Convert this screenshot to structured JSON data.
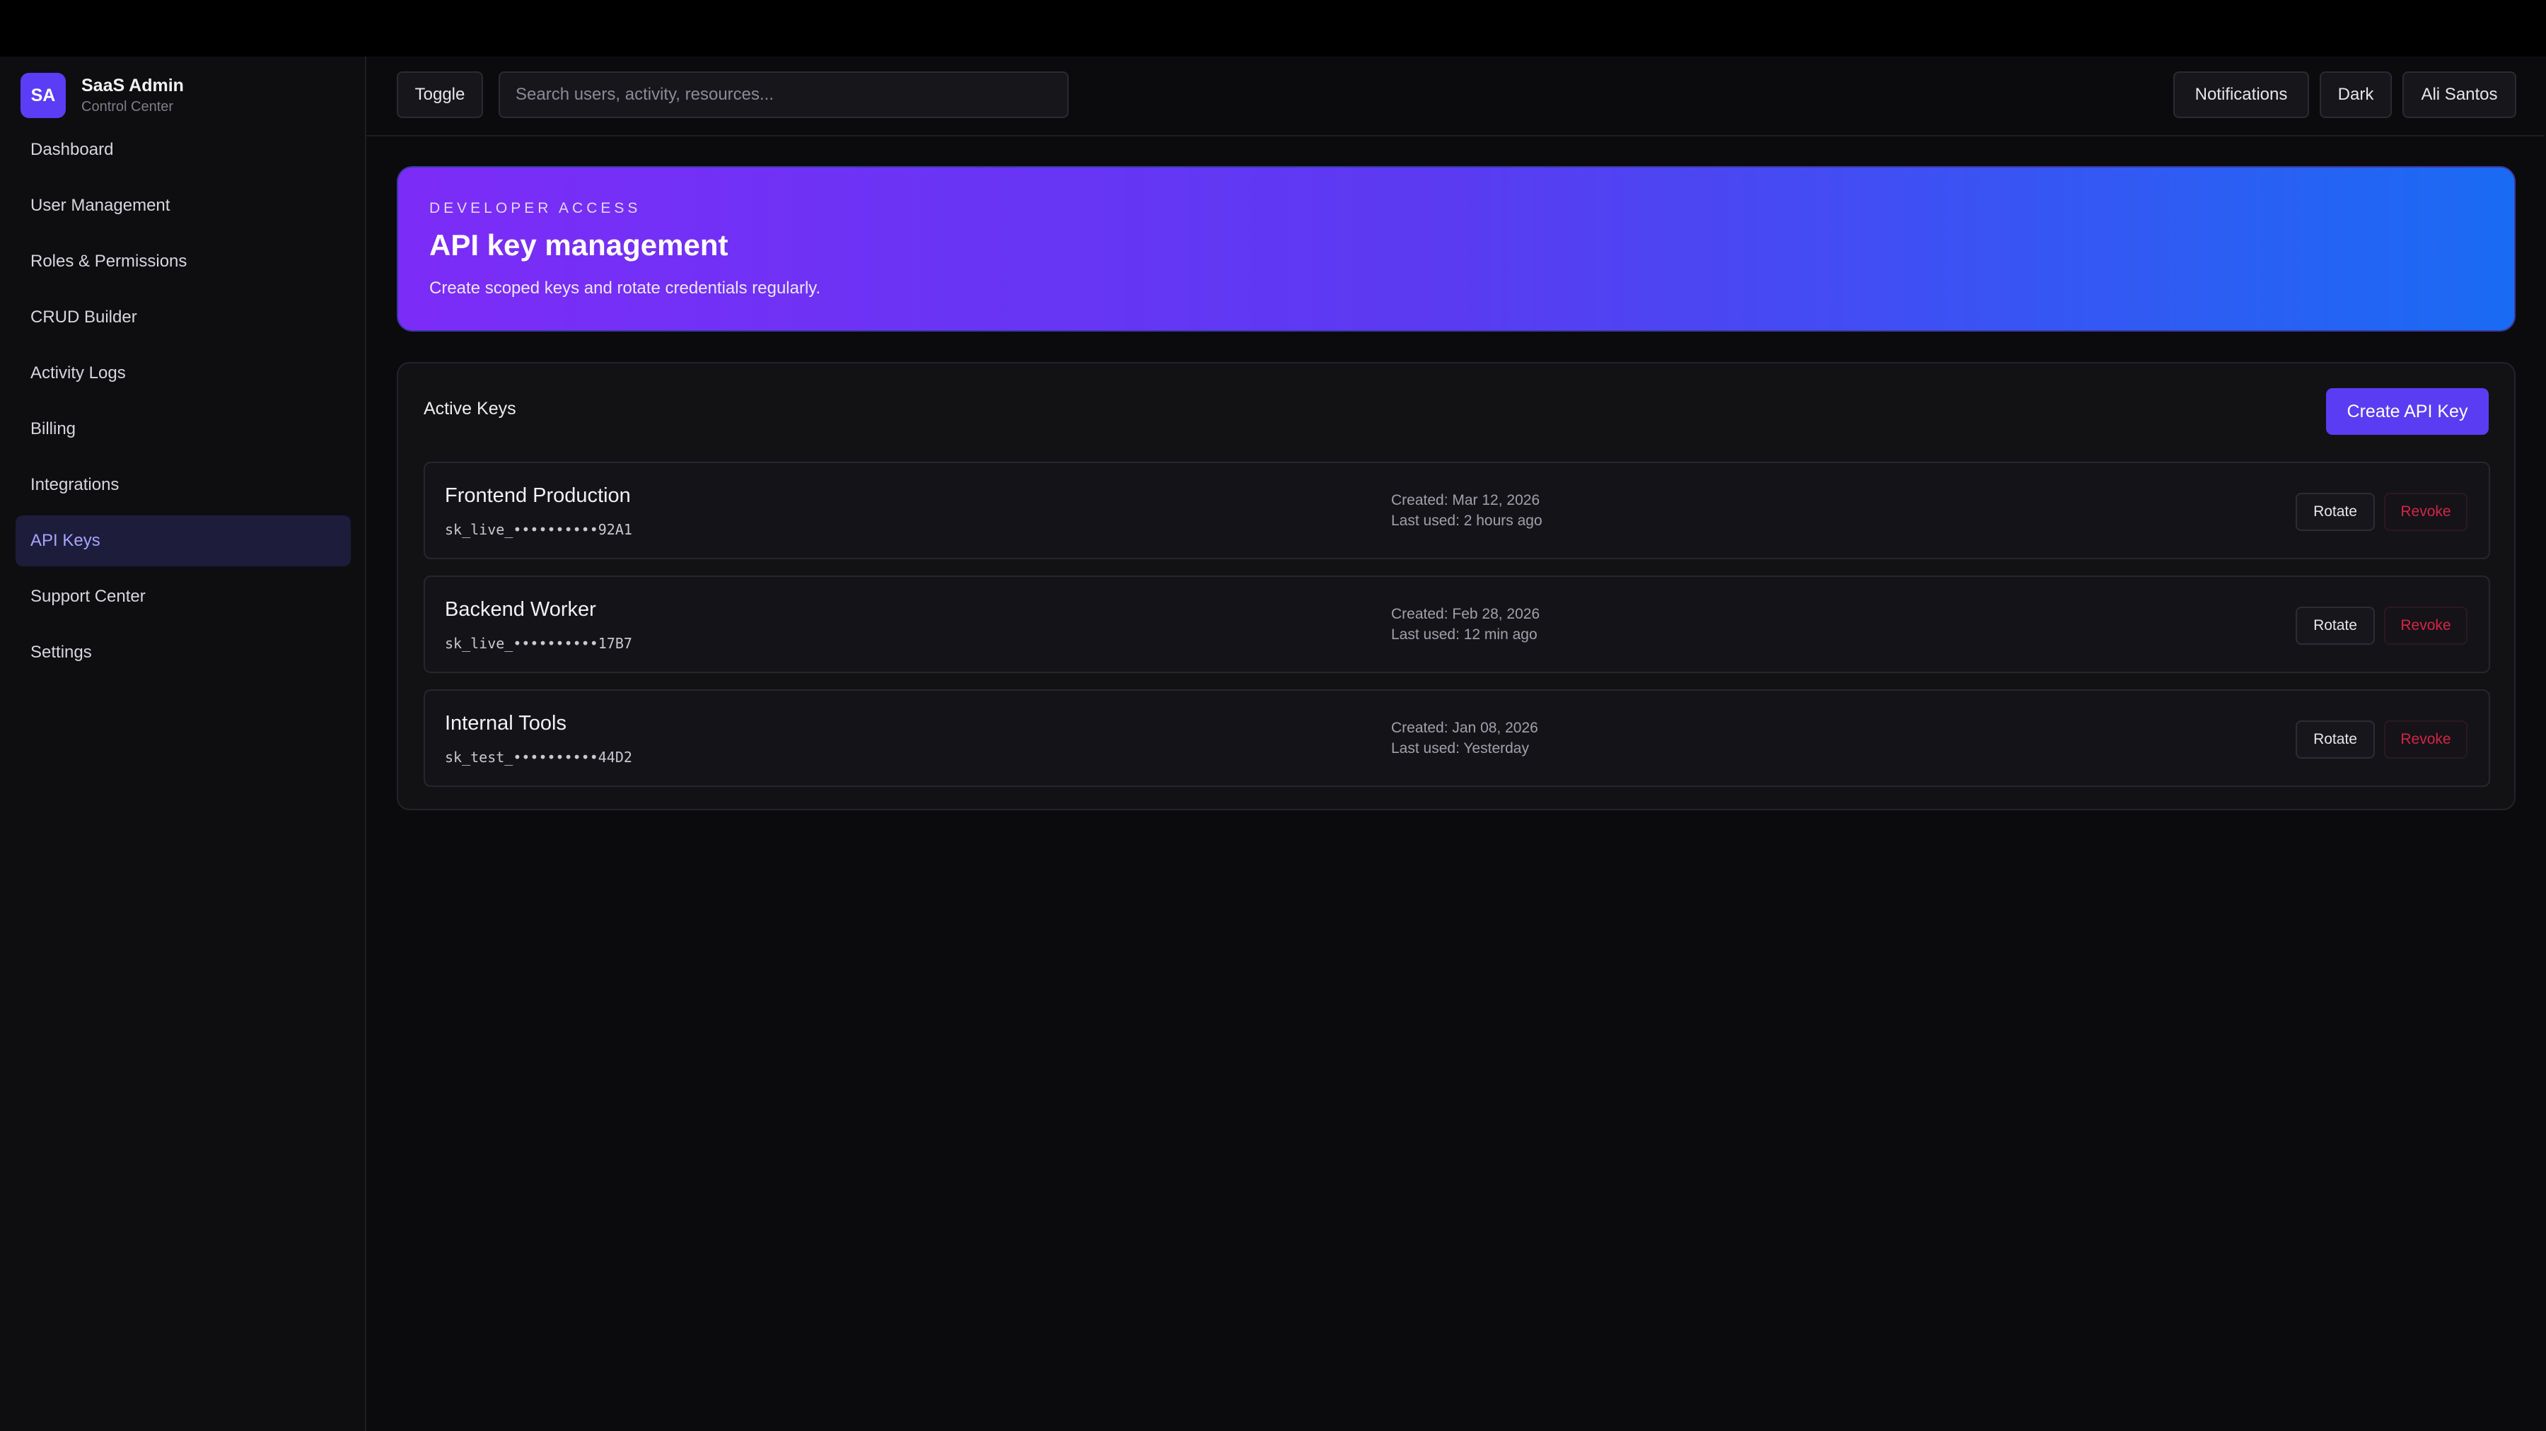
{
  "brand": {
    "badge": "SA",
    "name": "SaaS Admin",
    "subtitle": "Control Center"
  },
  "sidebar": {
    "items": [
      {
        "label": "Dashboard",
        "active": false
      },
      {
        "label": "User Management",
        "active": false
      },
      {
        "label": "Roles & Permissions",
        "active": false
      },
      {
        "label": "CRUD Builder",
        "active": false
      },
      {
        "label": "Activity Logs",
        "active": false
      },
      {
        "label": "Billing",
        "active": false
      },
      {
        "label": "Integrations",
        "active": false
      },
      {
        "label": "API Keys",
        "active": true
      },
      {
        "label": "Support Center",
        "active": false
      },
      {
        "label": "Settings",
        "active": false
      }
    ]
  },
  "topbar": {
    "toggle_label": "Toggle",
    "search_placeholder": "Search users, activity, resources...",
    "notifications_label": "Notifications",
    "theme_label": "Dark",
    "user_label": "Ali Santos"
  },
  "hero": {
    "kicker": "DEVELOPER ACCESS",
    "title": "API key management",
    "description": "Create scoped keys and rotate credentials regularly."
  },
  "keys_panel": {
    "title": "Active Keys",
    "create_label": "Create API Key",
    "rows": [
      {
        "name": "Frontend Production",
        "masked": "sk_live_••••••••••92A1",
        "created": "Created: Mar 12, 2026",
        "last_used": "Last used: 2 hours ago",
        "rotate_label": "Rotate",
        "revoke_label": "Revoke"
      },
      {
        "name": "Backend Worker",
        "masked": "sk_live_••••••••••17B7",
        "created": "Created: Feb 28, 2026",
        "last_used": "Last used: 12 min ago",
        "rotate_label": "Rotate",
        "revoke_label": "Revoke"
      },
      {
        "name": "Internal Tools",
        "masked": "sk_test_••••••••••44D2",
        "created": "Created: Jan 08, 2026",
        "last_used": "Last used: Yesterday",
        "rotate_label": "Rotate",
        "revoke_label": "Revoke"
      }
    ]
  },
  "colors": {
    "accent": "#5a3df2",
    "danger": "#d2254a",
    "hero_gradient_start": "#7c2cf7",
    "hero_gradient_end": "#1a6bf4"
  }
}
